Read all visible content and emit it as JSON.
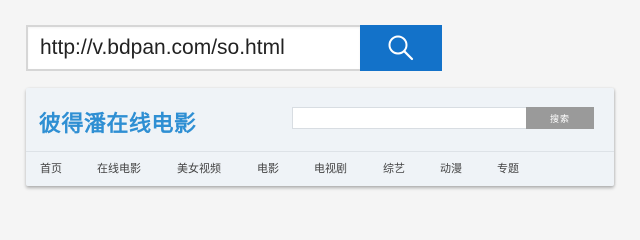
{
  "address_bar": {
    "url": "http://v.bdpan.com/so.html",
    "search_icon": "magnifier-icon",
    "button_color": "#1372c9"
  },
  "site": {
    "title": "彼得潘在线电影",
    "title_color": "#2f8fd3",
    "search": {
      "value": "",
      "button_label": "搜索"
    },
    "nav": [
      "首页",
      "在线电影",
      "美女视频",
      "电影",
      "电视剧",
      "综艺",
      "动漫",
      "专题"
    ]
  }
}
